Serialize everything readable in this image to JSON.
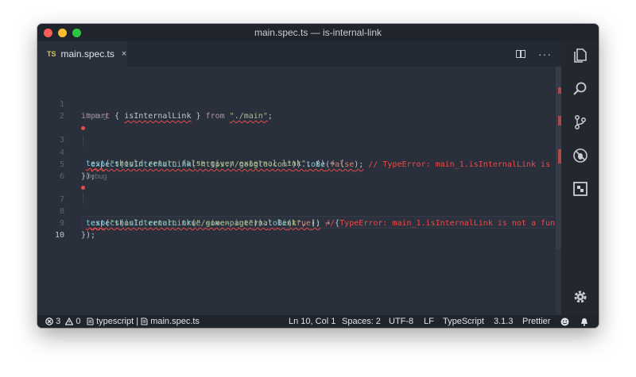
{
  "window": {
    "title": "main.spec.ts — is-internal-link"
  },
  "tab": {
    "language_badge": "TS",
    "filename": "main.spec.ts",
    "close_glyph": "×"
  },
  "tab_actions": {
    "more_glyph": "···"
  },
  "editor": {
    "line_numbers": [
      "1",
      "2",
      "3",
      "4",
      "5",
      "6",
      "7",
      "8",
      "9",
      "10"
    ],
    "codelens_debug": "Debug",
    "line1": {
      "kw_import": "import",
      "p1": " { ",
      "ident": "isInternalLink",
      "p2": " } ",
      "kw_from": "from",
      "p3": " ",
      "module": "\"./main\"",
      "p4": ";"
    },
    "line3": {
      "fn": "test",
      "p1": "(",
      "desc": "\"should return false given external link\"",
      "p2": ", () ⇒ {"
    },
    "line4": {
      "indent": "  ",
      "fn": "expect",
      "p1": "(",
      "callee": "isInternalLink",
      "p2": "(",
      "url": "\"https://google.com\"",
      "p3": ")).",
      "method": "toBe",
      "p4": "(",
      "value": "false",
      "p5": ");",
      "error": " // TypeError: main_1.isInternalLink is no"
    },
    "line5": {
      "text": "});"
    },
    "line7": {
      "fn": "test",
      "p1": "(",
      "desc": "\"should return true given internal link\"",
      "p2": ", () ⇒ {"
    },
    "line8": {
      "indent": "  ",
      "fn": "expect",
      "p1": "(",
      "callee": "isInternalLink",
      "p2": "(",
      "url": "\"/some-page\"",
      "p3": ")).",
      "method": "toBe",
      "p4": "(",
      "value": "true",
      "p5": ");",
      "error": " // TypeError: main_1.isInternalLink is not a funct"
    },
    "line9": {
      "text": "});"
    }
  },
  "activity_icons": [
    "files-icon",
    "search-icon",
    "source-control-icon",
    "debug-icon",
    "extensions-icon",
    "settings-gear-icon"
  ],
  "status_bar": {
    "errors_count": "3",
    "warnings_count": "0",
    "language_crumb": "typescript",
    "separator": "|",
    "file_crumb": "main.spec.ts",
    "cursor_position": "Ln 10, Col 1",
    "indentation": "Spaces: 2",
    "encoding": "UTF-8",
    "line_ending": "LF",
    "language_mode": "TypeScript",
    "ts_version": "3.1.3",
    "formatter": "Prettier"
  },
  "colors": {
    "editor_bg": "#2a303b",
    "titlebar_bg": "#1f242d",
    "error_red": "#e84a4a",
    "string_green": "#a3be8c",
    "keyword_purple": "#b48ead"
  }
}
